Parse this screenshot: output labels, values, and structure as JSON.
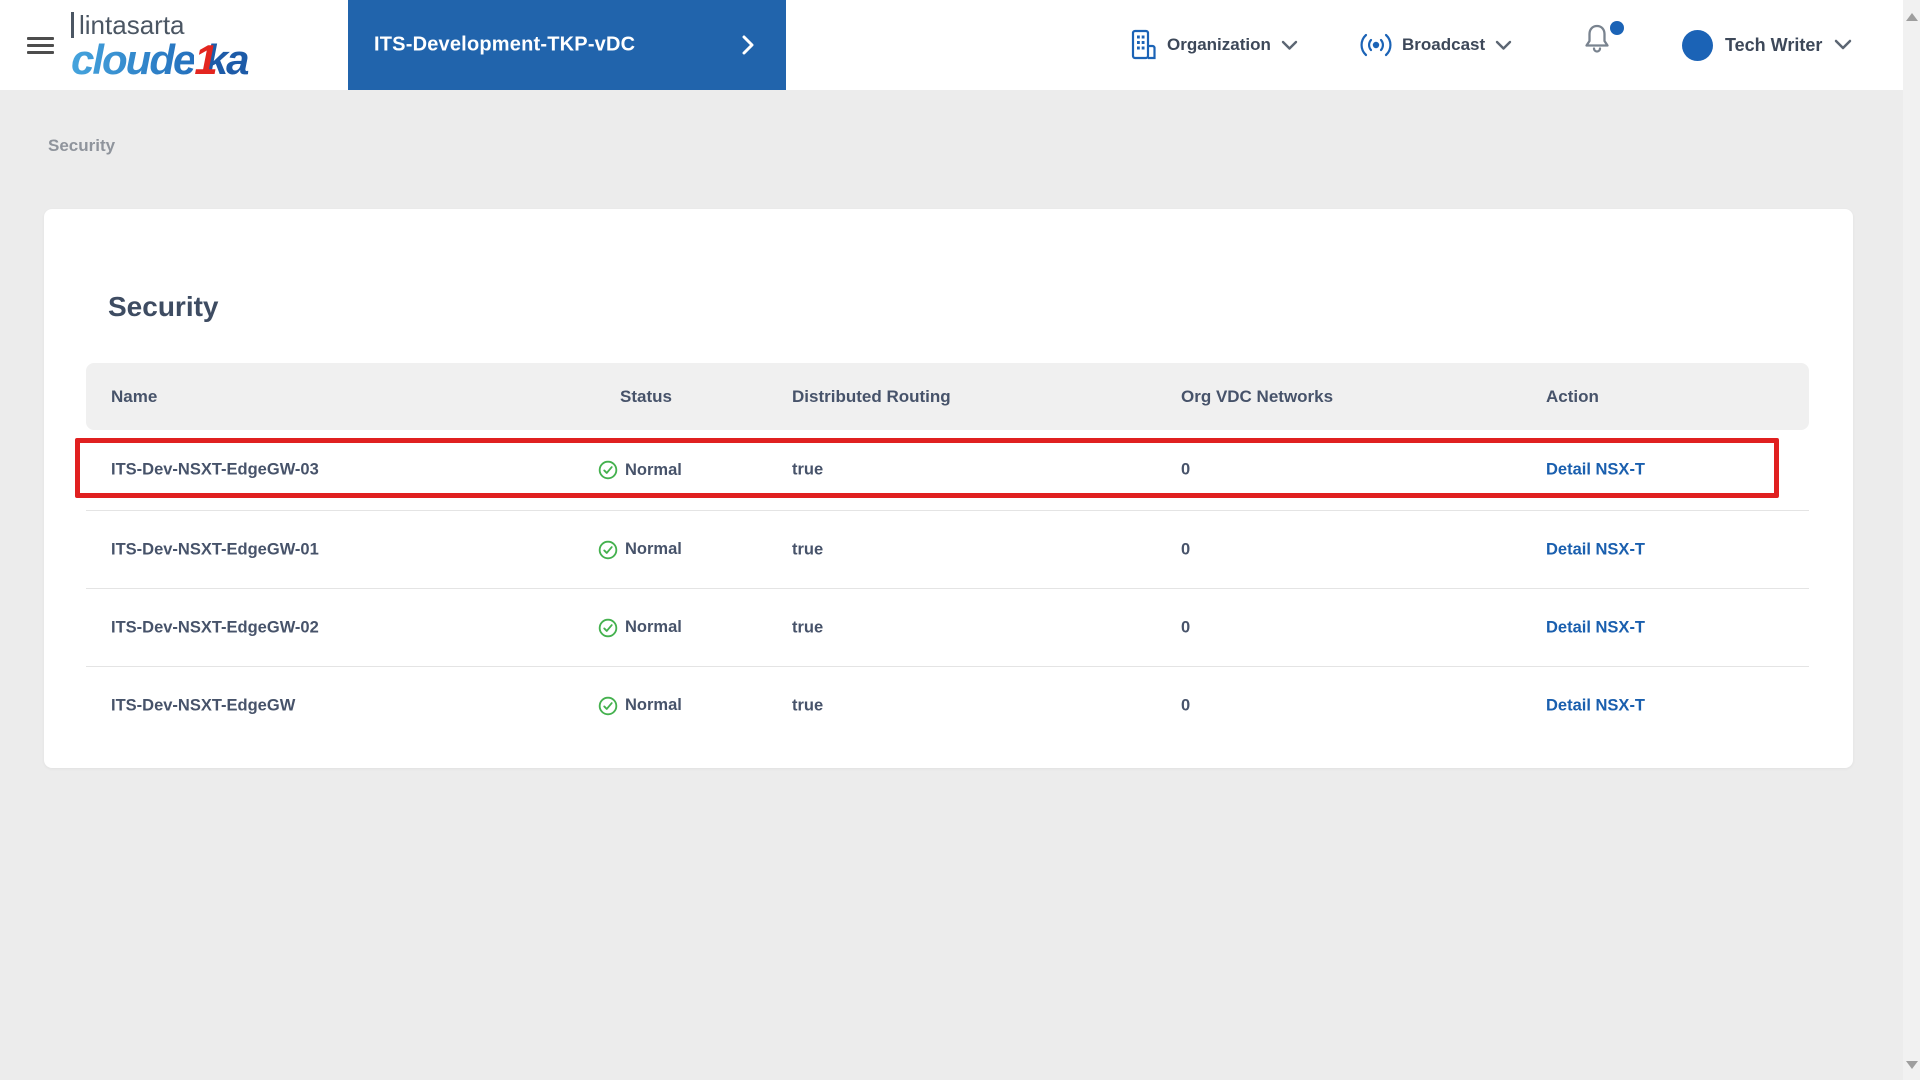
{
  "header": {
    "logo": {
      "company": "lintasarta",
      "brand_prefix": "cloude",
      "brand_accent": "1",
      "brand_suffix": "ka"
    },
    "vdc_selector": {
      "label": "ITS-Development-TKP-vDC"
    },
    "organization_menu": {
      "label": "Organization"
    },
    "broadcast_menu": {
      "label": "Broadcast"
    },
    "notifications": {
      "has_unread_dot": true
    },
    "user_menu": {
      "name": "Tech Writer"
    }
  },
  "breadcrumb": {
    "current": "Security"
  },
  "main": {
    "card_title": "Security",
    "table": {
      "columns": [
        {
          "label": "Name"
        },
        {
          "label": "Status"
        },
        {
          "label": "Distributed Routing"
        },
        {
          "label": "Org VDC Networks"
        },
        {
          "label": "Action"
        }
      ],
      "rows": [
        {
          "name": "ITS-Dev-NSXT-EdgeGW-03",
          "status": "Normal",
          "distributed_routing": "true",
          "org_vdc_networks": "0",
          "action": "Detail NSX-T",
          "highlighted": true
        },
        {
          "name": "ITS-Dev-NSXT-EdgeGW-01",
          "status": "Normal",
          "distributed_routing": "true",
          "org_vdc_networks": "0",
          "action": "Detail NSX-T",
          "highlighted": false
        },
        {
          "name": "ITS-Dev-NSXT-EdgeGW-02",
          "status": "Normal",
          "distributed_routing": "true",
          "org_vdc_networks": "0",
          "action": "Detail NSX-T",
          "highlighted": false
        },
        {
          "name": "ITS-Dev-NSXT-EdgeGW",
          "status": "Normal",
          "distributed_routing": "true",
          "org_vdc_networks": "0",
          "action": "Detail NSX-T",
          "highlighted": false
        }
      ]
    }
  },
  "colors": {
    "accent_blue": "#2164ac",
    "icon_blue": "#1b63b6",
    "link_blue": "#1a5fae",
    "status_green": "#44b14e",
    "highlight_red": "#e02020",
    "brand_red": "#e3251f",
    "page_background": "#ececec"
  }
}
